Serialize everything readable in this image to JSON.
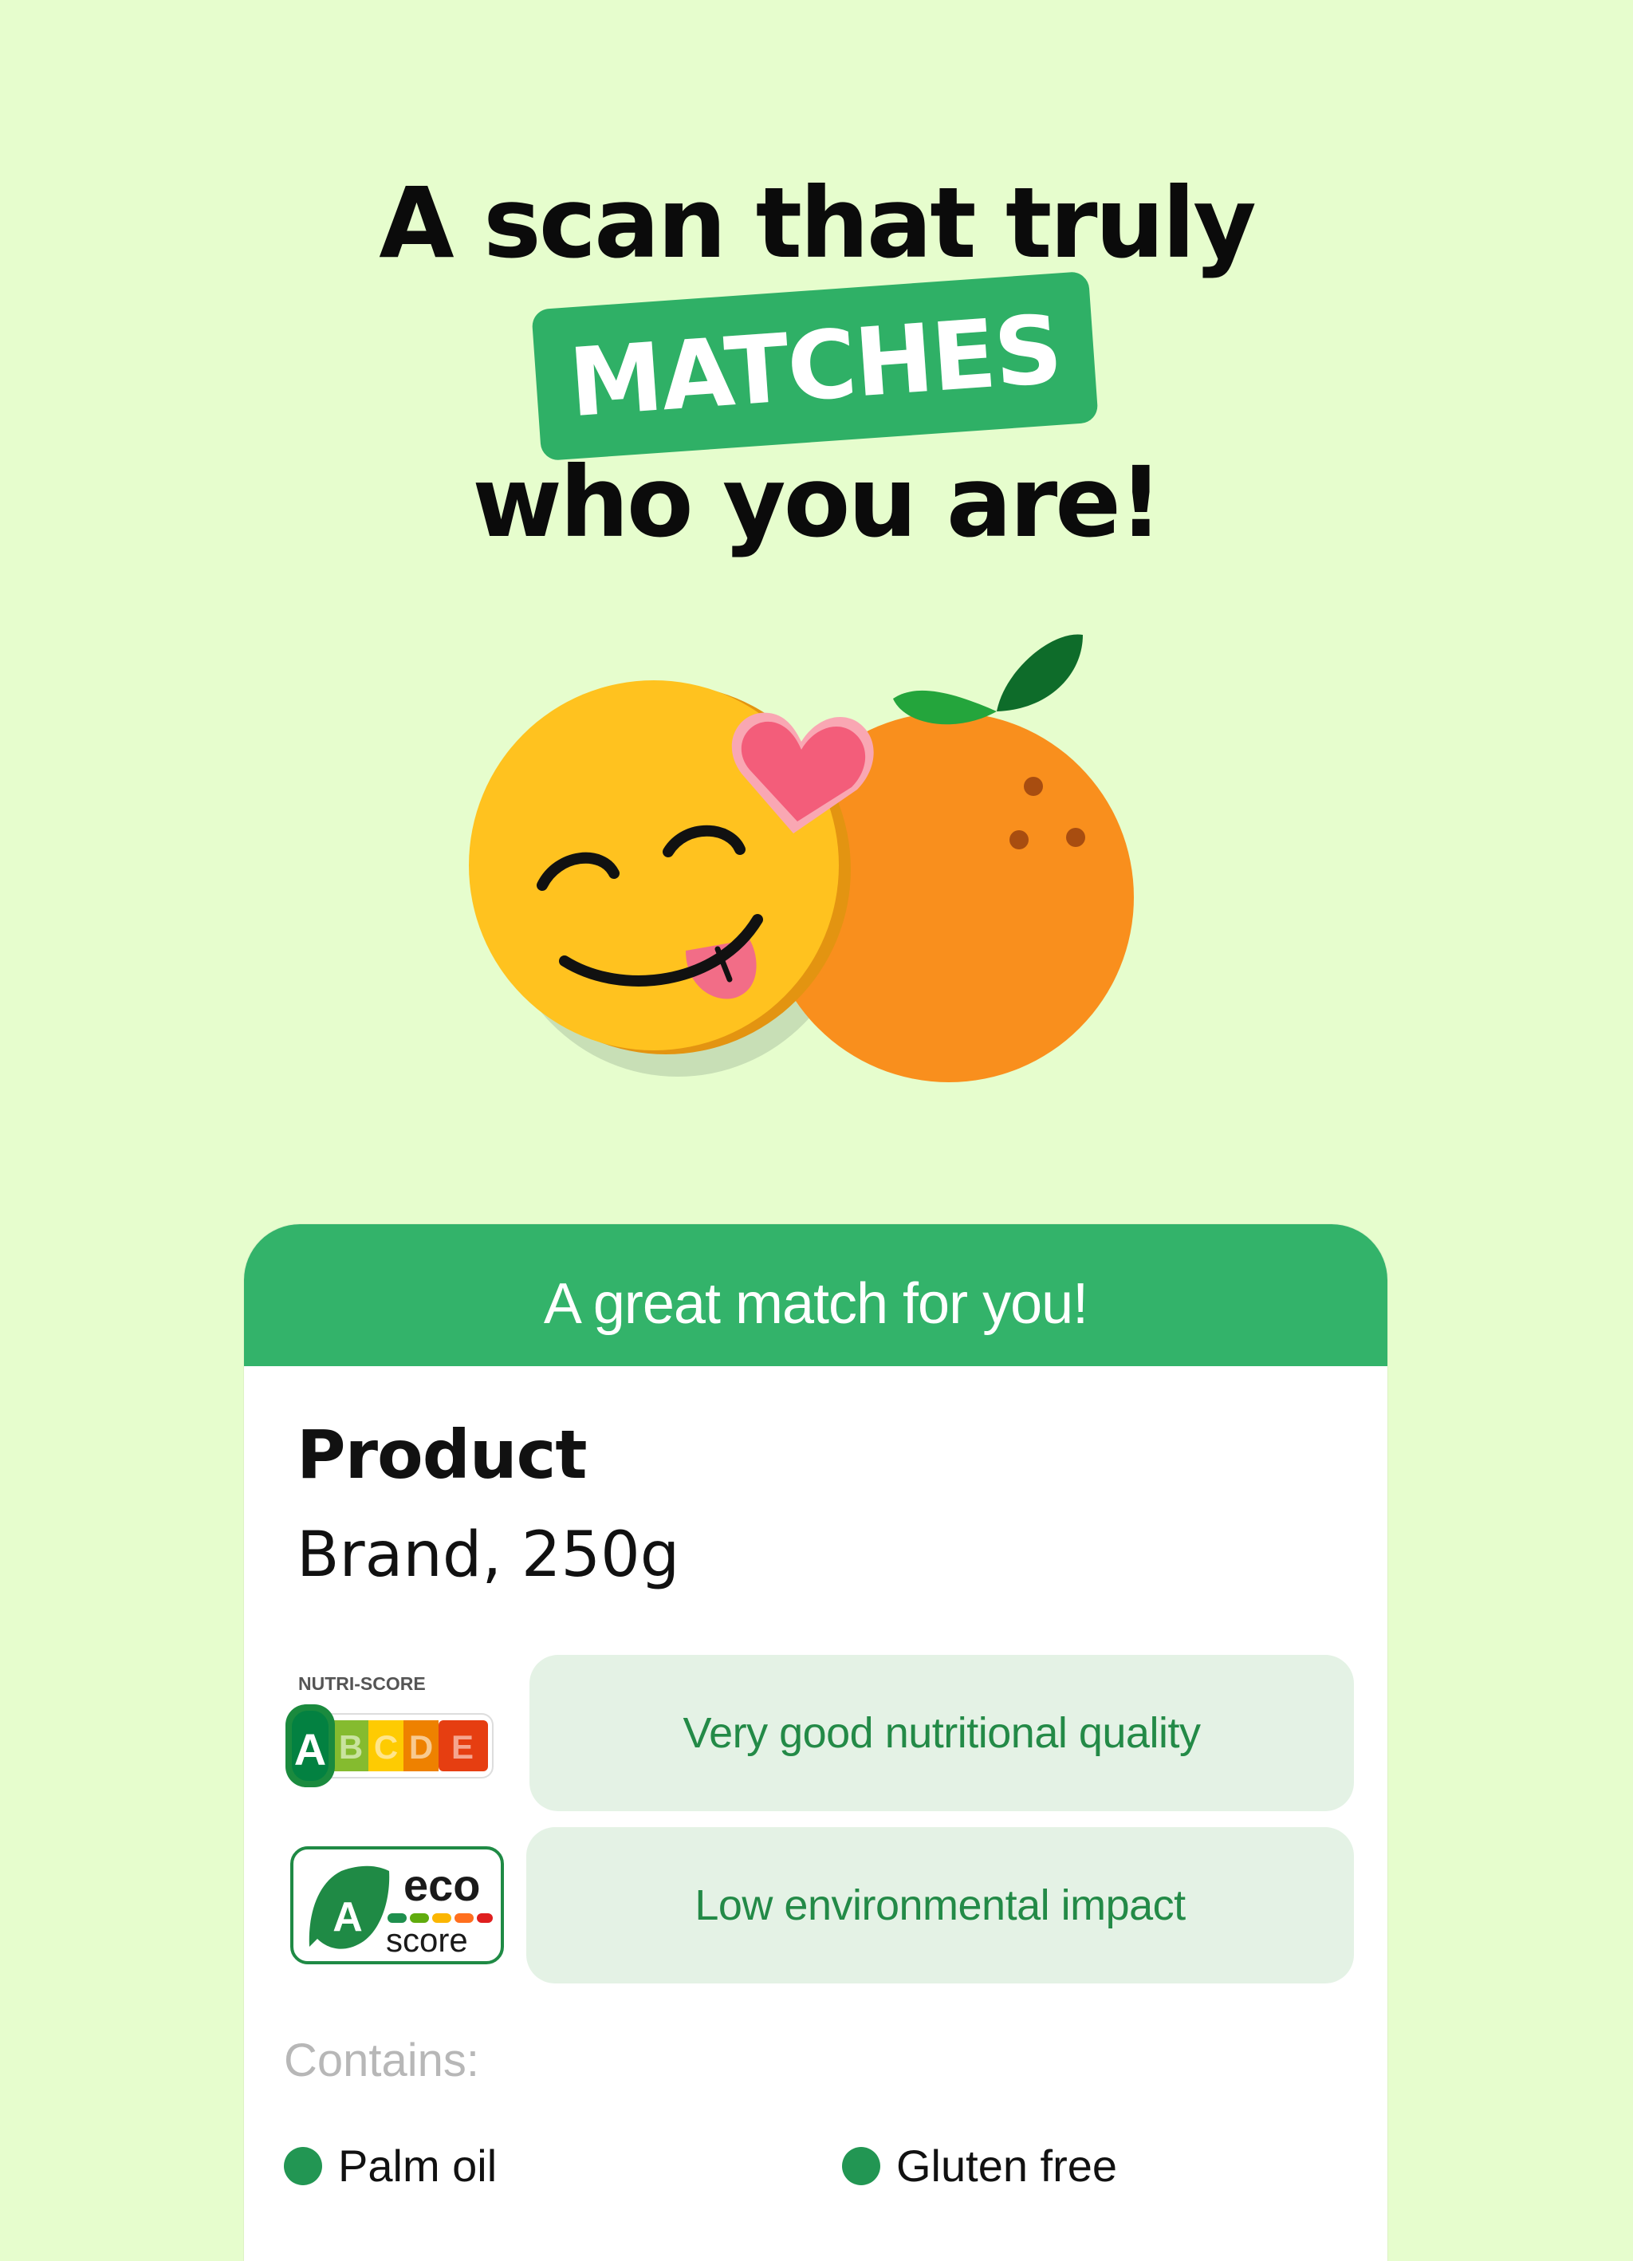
{
  "headline": {
    "line1": "A scan that truly",
    "highlight": "MATCHES",
    "line3": "who you are!"
  },
  "illustration": {
    "left_character": "smiley-face-tongue-out",
    "right_character": "orange-fruit",
    "accent": "heart"
  },
  "colors": {
    "background": "#e6fdcd",
    "brand_green": "#33b36a",
    "pill_bg": "#e4f2e5",
    "pill_text": "#238a47"
  },
  "card": {
    "header": "A great match for you!",
    "product_name": "Product",
    "product_brand": "Brand, 250g",
    "nutri_score": {
      "logo_label": "NUTRI-SCORE",
      "grades": [
        "A",
        "B",
        "C",
        "D",
        "E"
      ],
      "selected": "A",
      "description": "Very good nutritional quality"
    },
    "eco_score": {
      "grade": "A",
      "logo_word1": "eco",
      "logo_word2": "score",
      "description": "Low environmental impact"
    },
    "contains_label": "Contains:",
    "tags": [
      {
        "label": "Palm oil",
        "color": "#229653"
      },
      {
        "label": "Gluten free",
        "color": "#229653"
      }
    ]
  }
}
